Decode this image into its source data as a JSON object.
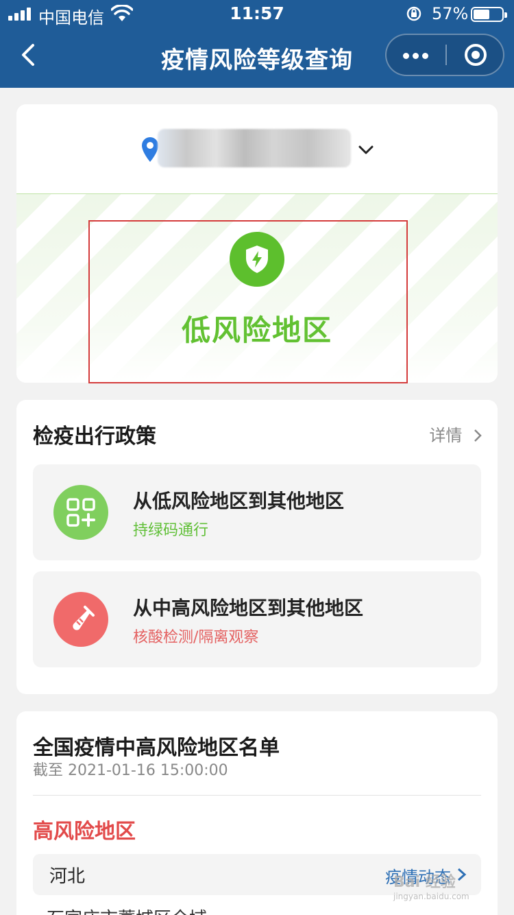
{
  "status_bar": {
    "carrier": "中国电信",
    "time": "11:57",
    "battery": "57%",
    "battery_level": 0.57
  },
  "nav": {
    "title": "疫情风险等级查询",
    "icons": [
      "back-arrow-icon",
      "more-dots-icon",
      "close-circle-icon"
    ]
  },
  "location": {
    "name": "",
    "icon": "location-pin-icon"
  },
  "risk": {
    "level": "低风险地区",
    "icon": "shield-bolt-icon",
    "color": "#62c132"
  },
  "policy": {
    "title": "检疫出行政策",
    "detail": "详情",
    "items": [
      {
        "title": "从低风险地区到其他地区",
        "subtitle": "持绿码通行",
        "icon": "qr-code-icon",
        "color": "#80cf5e"
      },
      {
        "title": "从中高风险地区到其他地区",
        "subtitle": "核酸检测/隔离观察",
        "icon": "test-tube-icon",
        "color": "#f06a6a"
      }
    ]
  },
  "risk_list": {
    "title": "全国疫情中高风险地区名单",
    "updated": "截至 2021-01-16 15:00:00",
    "high_title": "高风险地区",
    "provinces": [
      {
        "name": "河北",
        "link": "疫情动态",
        "districts": [
          "石家庄市藁城区全域"
        ]
      }
    ]
  },
  "watermark": {
    "text": "Bai 经验",
    "url": "jingyan.baidu.com"
  }
}
